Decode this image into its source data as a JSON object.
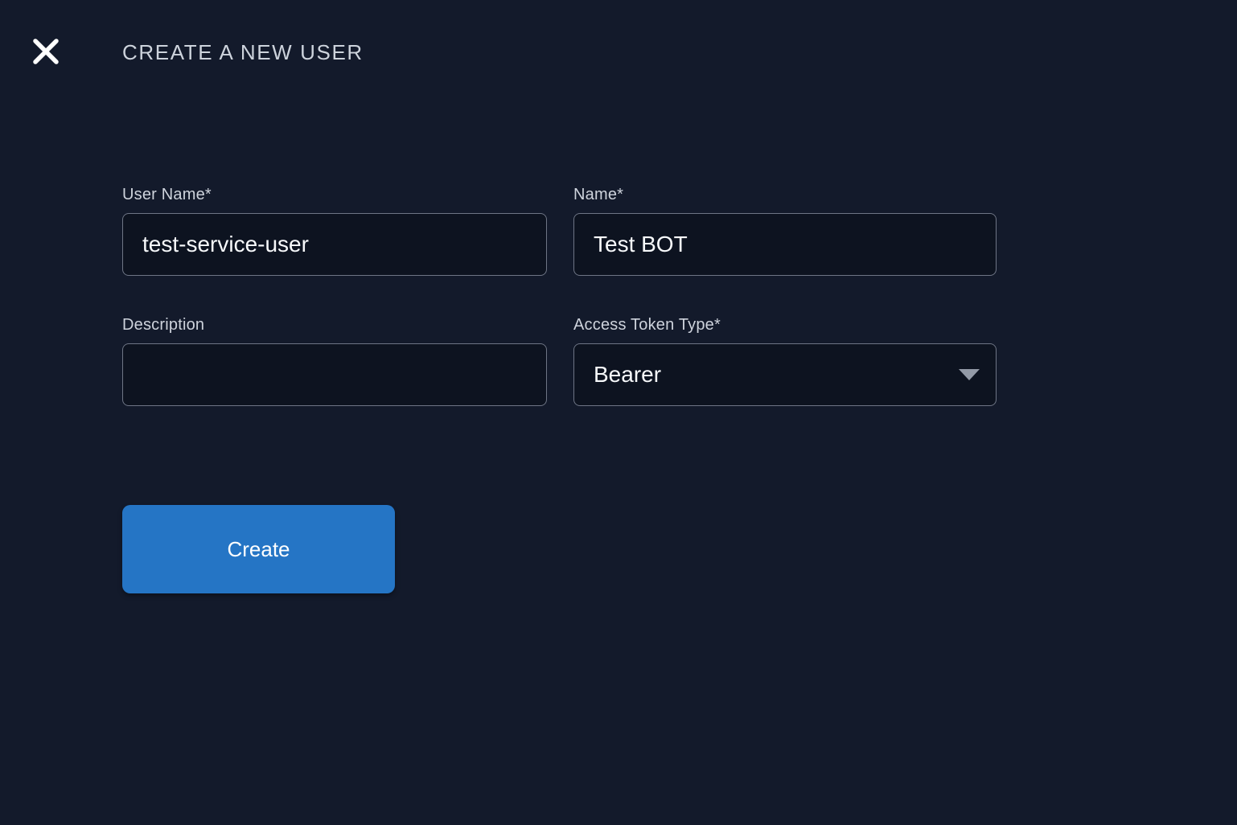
{
  "header": {
    "title": "CREATE A NEW USER"
  },
  "icons": {
    "close": "close-icon",
    "dropdown": "caret-down-icon"
  },
  "form": {
    "fields": {
      "user_name": {
        "label": "User Name*",
        "value": "test-service-user"
      },
      "name": {
        "label": "Name*",
        "value": "Test BOT"
      },
      "description": {
        "label": "Description",
        "value": ""
      },
      "access_token_type": {
        "label": "Access Token Type*",
        "value": "Bearer"
      }
    },
    "submit_label": "Create"
  },
  "colors": {
    "background": "#131a2b",
    "input_background": "#0d1320",
    "input_border": "#6e7585",
    "label_text": "#ced3dc",
    "value_text": "#f7f9fb",
    "accent_blue": "#2575c5"
  }
}
